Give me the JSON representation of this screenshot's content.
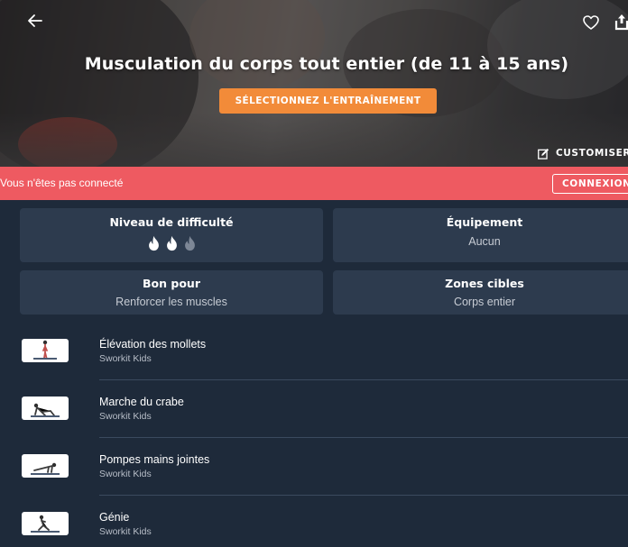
{
  "hero": {
    "title": "Musculation du corps tout entier (de 11 à 15 ans)",
    "select_label": "SÉLECTIONNEZ L'ENTRAÎNEMENT",
    "customise_label": "CUSTOMISER",
    "back_icon": "arrow-left-icon",
    "favorite_icon": "heart-icon",
    "share_icon": "share-icon",
    "customise_icon": "edit-icon"
  },
  "alert": {
    "message": "Vous n'êtes pas connecté",
    "login_label": "CONNEXION"
  },
  "info": {
    "difficulty_title": "Niveau de difficulté",
    "difficulty_level": 2,
    "difficulty_max": 3,
    "equipment_title": "Équipement",
    "equipment_value": "Aucun",
    "good_for_title": "Bon pour",
    "good_for_value": "Renforcer les muscles",
    "zones_title": "Zones cibles",
    "zones_value": "Corps entier"
  },
  "exercises": [
    {
      "name": "Élévation des mollets",
      "source": "Sworkit Kids"
    },
    {
      "name": "Marche du crabe",
      "source": "Sworkit Kids"
    },
    {
      "name": "Pompes mains jointes",
      "source": "Sworkit Kids"
    },
    {
      "name": "Génie",
      "source": "Sworkit Kids"
    }
  ],
  "colors": {
    "background": "#1e2a3a",
    "card": "#2d3b4e",
    "accent_orange": "#f28b39",
    "alert_red": "#ee5a61",
    "flame_active": "#ffffff",
    "flame_inactive": "#7d8796"
  }
}
